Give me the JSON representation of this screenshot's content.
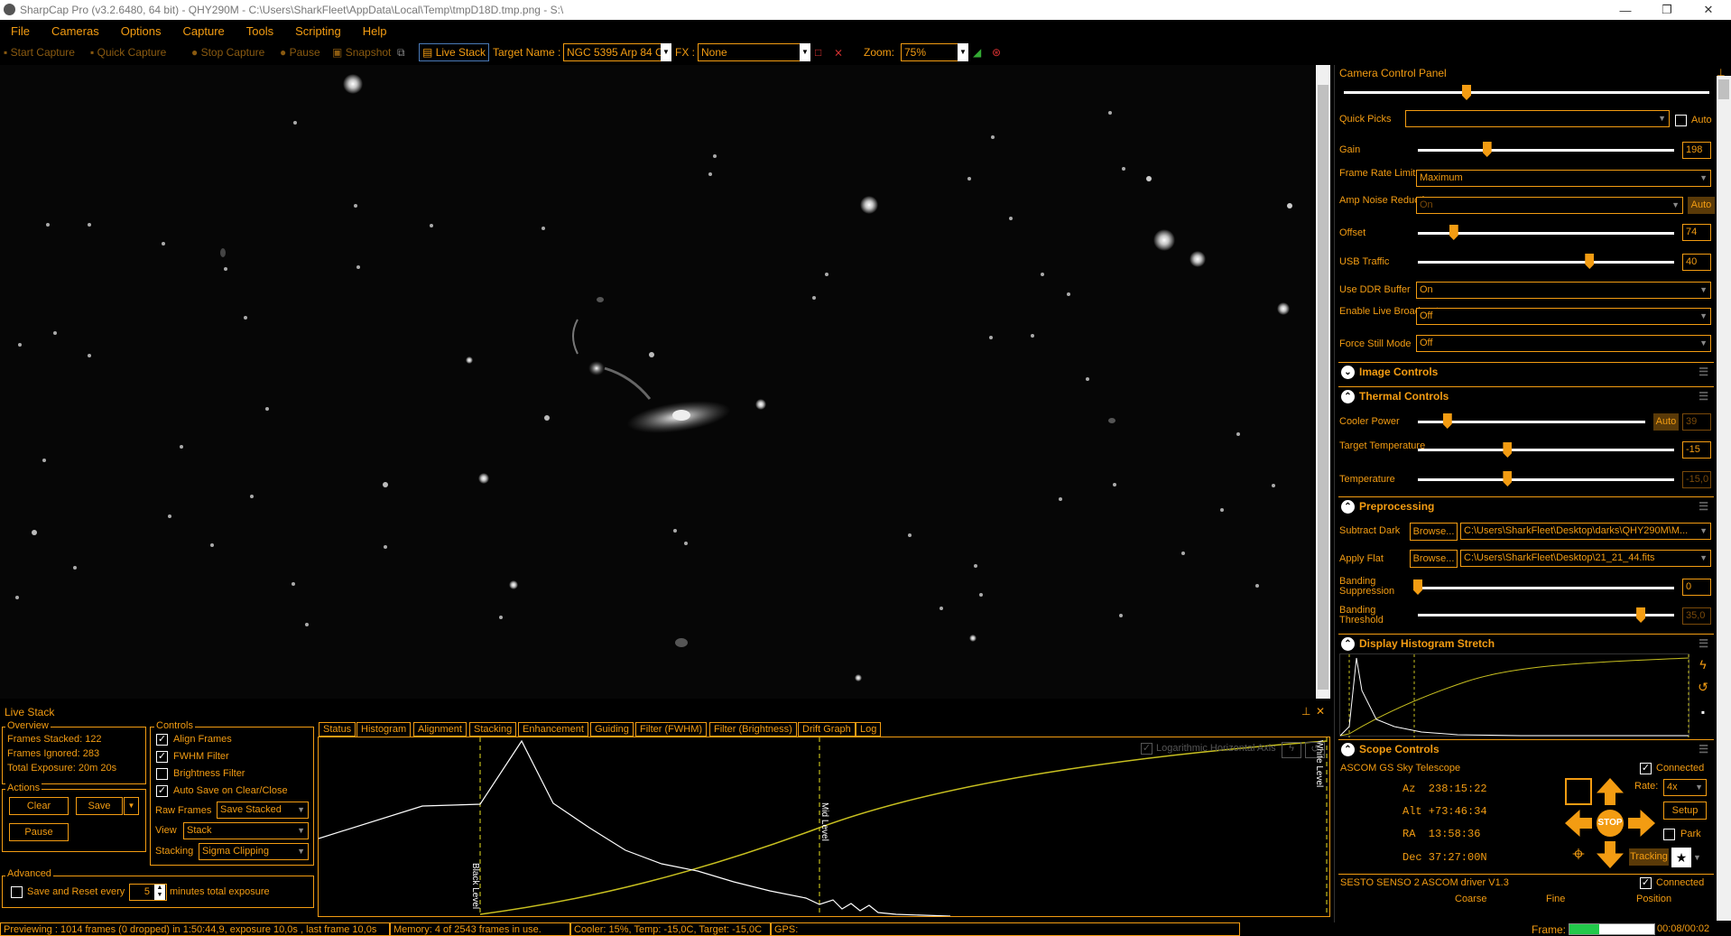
{
  "window": {
    "title": "SharpCap Pro (v3.2.6480, 64 bit) - QHY290M - C:\\Users\\SharkFleet\\AppData\\Local\\Temp\\tmpD18D.tmp.png - S:\\",
    "controls": [
      "—",
      "❐",
      "✕"
    ]
  },
  "menu": [
    "File",
    "Cameras",
    "Options",
    "Capture",
    "Tools",
    "Scripting",
    "Help"
  ],
  "toolbar": {
    "start_capture": "Start Capture",
    "quick_capture": "Quick Capture",
    "stop_capture": "Stop Capture",
    "pause": "Pause",
    "snapshot": "Snapshot",
    "live_stack": "Live Stack",
    "target_name_label": "Target Name :",
    "target_name_value": "NGC 5395 Arp 84 C",
    "fx_label": "FX :",
    "fx_value": "None",
    "zoom_label": "Zoom:",
    "zoom_value": "75%"
  },
  "camera_panel": {
    "title": "Camera Control Panel",
    "quick_picks_label": "Quick Picks",
    "auto_label": "Auto",
    "gain": {
      "label": "Gain",
      "value": "198",
      "level": 0.27
    },
    "frame_rate": {
      "label": "Frame Rate Limit",
      "value": "Maximum"
    },
    "amp_noise": {
      "label": "Amp Noise Reduction",
      "value": "On",
      "auto": "Auto"
    },
    "offset": {
      "label": "Offset",
      "value": "74",
      "level": 0.14
    },
    "usb_traffic": {
      "label": "USB Traffic",
      "value": "40",
      "level": 0.67
    },
    "ddr": {
      "label": "Use DDR Buffer",
      "value": "On"
    },
    "live_broadcast": {
      "label": "Enable Live Broadcast",
      "value": "Off"
    },
    "still_mode": {
      "label": "Force Still Mode",
      "value": "Off"
    }
  },
  "image_controls": {
    "title": "Image Controls"
  },
  "thermal": {
    "title": "Thermal Controls",
    "cooler_power": {
      "label": "Cooler Power",
      "auto": "Auto",
      "value": "39",
      "level": 0.13
    },
    "target_temp": {
      "label": "Target Temperature",
      "value": "-15",
      "level": 0.35
    },
    "temperature": {
      "label": "Temperature",
      "value": "-15,0",
      "level": 0.35
    }
  },
  "preprocessing": {
    "title": "Preprocessing",
    "subtract_dark": {
      "label": "Subtract Dark",
      "button": "Browse...",
      "value": "C:\\Users\\SharkFleet\\Desktop\\darks\\QHY290M\\M..."
    },
    "apply_flat": {
      "label": "Apply Flat",
      "button": "Browse...",
      "value": "C:\\Users\\SharkFleet\\Desktop\\21_21_44.fits"
    },
    "banding_suppression": {
      "label": "Banding Suppression",
      "value": "0",
      "level": 0.0
    },
    "banding_threshold": {
      "label": "Banding Threshold",
      "value": "35,0",
      "level": 0.87
    }
  },
  "display_stretch": {
    "title": "Display Histogram Stretch"
  },
  "scope": {
    "title": "Scope Controls",
    "device": "ASCOM GS Sky Telescope",
    "connected": "Connected",
    "az": "Az  238:15:22",
    "alt": "Alt +73:46:34",
    "ra": "RA  13:58:36",
    "dec": "Dec 37:27:00N",
    "rate_label": "Rate:",
    "rate_value": "4x",
    "setup": "Setup",
    "park": "Park",
    "tracking": "Tracking",
    "stop": "STOP"
  },
  "focuser": {
    "device": "SESTO SENSO 2 ASCOM driver V1.3",
    "connected": "Connected",
    "coarse": "Coarse",
    "fine": "Fine",
    "position": "Position"
  },
  "live_stack": {
    "title": "Live Stack",
    "overview_title": "Overview",
    "frames_stacked": "Frames Stacked:  122",
    "frames_ignored": "Frames Ignored:  283",
    "total_exposure": "Total Exposure:   20m 20s",
    "actions_title": "Actions",
    "clear": "Clear",
    "save": "Save",
    "pause": "Pause",
    "controls_title": "Controls",
    "align_frames": "Align Frames",
    "fwhm_filter": "FWHM Filter",
    "brightness_filter": "Brightness Filter",
    "auto_save": "Auto Save on Clear/Close",
    "raw_frames_label": "Raw Frames",
    "raw_frames_value": "Save Stacked",
    "view_label": "View",
    "view_value": "Stack",
    "stacking_label": "Stacking",
    "stacking_value": "Sigma Clipping",
    "advanced_title": "Advanced",
    "save_reset": "Save and Reset every",
    "minutes_value": "5",
    "minutes_label": "minutes total exposure",
    "tabs": [
      "Status",
      "Histogram",
      "Alignment",
      "Stacking",
      "Enhancement",
      "Guiding",
      "Filter (FWHM)",
      "Filter (Brightness)",
      "Drift Graph",
      "Log"
    ],
    "log_axis": "Logarithmic Horizontal Axis",
    "black_level": "Black Level",
    "mid_level": "Mid Level",
    "white_level": "White Level"
  },
  "status": {
    "preview": "Previewing : 1014 frames (0 dropped) in 1:50:44,9, exposure 10,0s , last frame 10,0s",
    "memory": "Memory: 4 of 2543 frames in use.",
    "cooler": "Cooler: 15%, Temp: -15,0C, Target: -15,0C",
    "gps": "GPS:",
    "frame_label": "Frame:",
    "frame_time": "00:08/00:02",
    "frame_progress": 0.35
  }
}
